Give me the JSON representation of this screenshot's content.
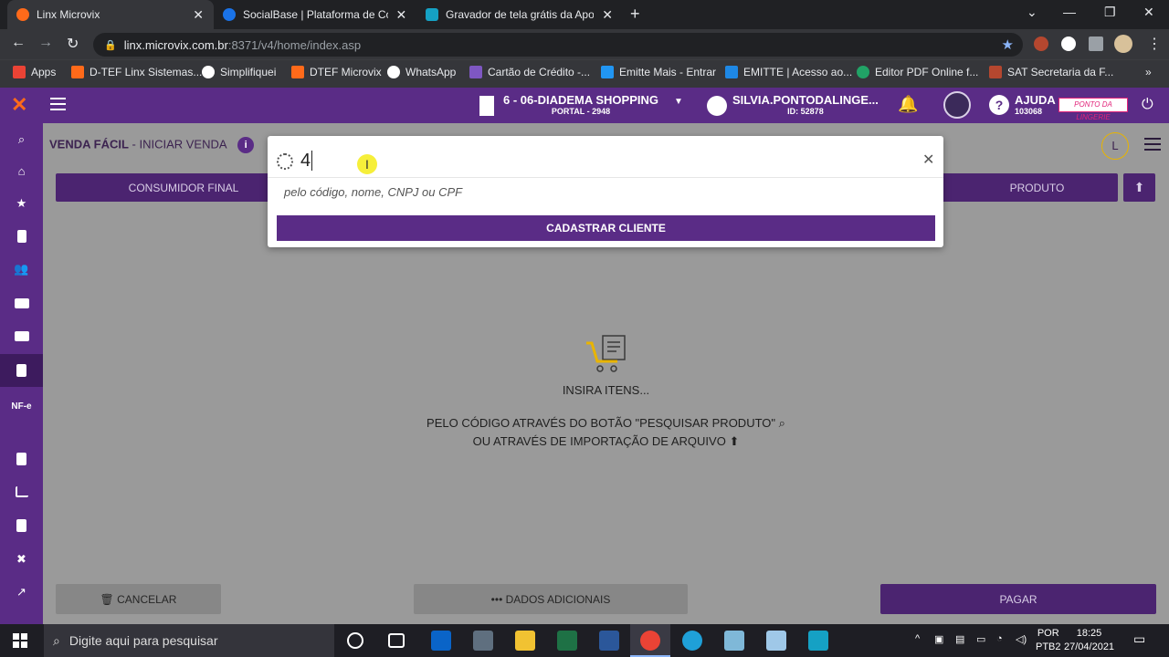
{
  "browser": {
    "tabs": [
      {
        "title": "Linx Microvix",
        "active": true
      },
      {
        "title": "SocialBase | Plataforma de Comu",
        "active": false
      },
      {
        "title": "Gravador de tela grátis da Apowe",
        "active": false
      }
    ],
    "url_host": "linx.microvix.com.br",
    "url_path": ":8371/v4/home/index.asp",
    "bookmarks": [
      {
        "label": "Apps",
        "icon": "apps-grid-icon"
      },
      {
        "label": "D-TEF Linx Sistemas...",
        "icon": "linx-icon"
      },
      {
        "label": "Simplifiquei",
        "icon": "globe-icon"
      },
      {
        "label": "DTEF Microvix",
        "icon": "linx-icon"
      },
      {
        "label": "WhatsApp",
        "icon": "whatsapp-icon"
      },
      {
        "label": "Cartão de Crédito -...",
        "icon": "card-icon"
      },
      {
        "label": "Emitte Mais - Entrar",
        "icon": "plus-icon"
      },
      {
        "label": "EMITTE | Acesso ao...",
        "icon": "emitte-icon"
      },
      {
        "label": "Editor PDF Online f...",
        "icon": "pdf-icon"
      },
      {
        "label": "SAT Secretaria da F...",
        "icon": "sat-icon"
      }
    ]
  },
  "header": {
    "store_name": "6 - 06-DIADEMA SHOPPING",
    "store_sub": "PORTAL - 2948",
    "user_name": "SILVIA.PONTODALINGE...",
    "user_id": "ID: 52878",
    "help_label": "AJUDA",
    "help_code": "103068",
    "brand_logo_text": "PONTO DA LINGERIE"
  },
  "sidebar": {
    "items": [
      {
        "name": "search",
        "label": ""
      },
      {
        "name": "home",
        "label": ""
      },
      {
        "name": "star",
        "label": ""
      },
      {
        "name": "building",
        "label": ""
      },
      {
        "name": "users",
        "label": ""
      },
      {
        "name": "money",
        "label": ""
      },
      {
        "name": "box",
        "label": ""
      },
      {
        "name": "document",
        "label": ""
      },
      {
        "name": "nfe",
        "label": "NF-e"
      },
      {
        "name": "clipboard",
        "label": ""
      },
      {
        "name": "chart",
        "label": ""
      },
      {
        "name": "file",
        "label": ""
      },
      {
        "name": "tools",
        "label": ""
      },
      {
        "name": "trend",
        "label": ""
      }
    ]
  },
  "main": {
    "title": "VENDA FÁCIL",
    "subtitle": " - INICIAR VENDA",
    "avatar_letter": "L",
    "consumer_button": "CONSUMIDOR FINAL",
    "product_button": "PRODUTO",
    "empty_title": "INSIRA ITENS...",
    "empty_line1": "PELO CÓDIGO ATRAVÉS DO BOTÃO \"PESQUISAR PRODUTO\"",
    "empty_line2": "OU ATRAVÉS DE IMPORTAÇÃO DE ARQUIVO",
    "cancel_button": "CANCELAR",
    "extra_button": "DADOS ADICIONAIS",
    "pay_button": "PAGAR"
  },
  "modal": {
    "query": "4",
    "hint": "pelo código, nome, CNPJ ou CPF",
    "register_button": "CADASTRAR CLIENTE"
  },
  "taskbar": {
    "search_placeholder": "Digite aqui para pesquisar",
    "lang": "POR",
    "lang_sub": "PTB2",
    "time": "18:25",
    "date": "27/04/2021"
  },
  "colors": {
    "brand_purple": "#5a2c86",
    "dark_purple": "#4b2470",
    "accent_orange": "#ff6a1a"
  }
}
